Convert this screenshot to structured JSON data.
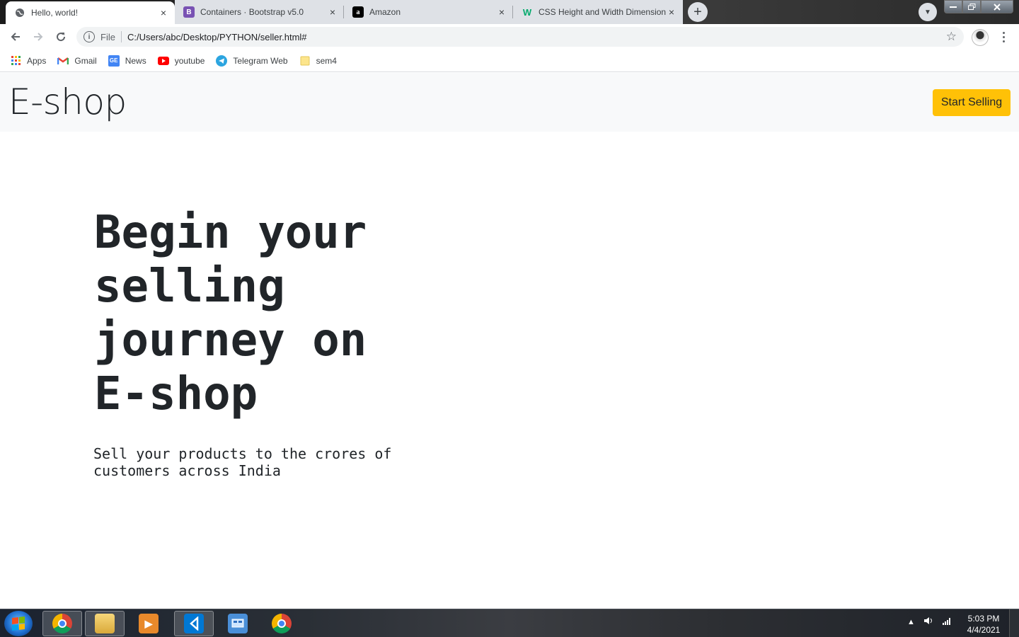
{
  "browser": {
    "tabs": [
      {
        "title": "Hello, world!",
        "favicon": "globe-icon",
        "active": true
      },
      {
        "title": "Containers · Bootstrap v5.0",
        "favicon": "B",
        "favicon_color": "#7952b3",
        "active": false
      },
      {
        "title": "Amazon",
        "favicon": "a",
        "favicon_color": "#000000",
        "active": false
      },
      {
        "title": "CSS Height and Width Dimensions",
        "favicon": "W",
        "favicon_color": "#04aa6d",
        "active": false
      }
    ],
    "new_tab_symbol": "+",
    "tab_close_symbol": "×",
    "address": {
      "scheme_label": "File",
      "url": "C:/Users/abc/Desktop/PYTHON/seller.html#"
    },
    "bookmarks": [
      {
        "label": "Apps",
        "icon": "apps-grid-icon"
      },
      {
        "label": "Gmail",
        "icon": "gmail-icon"
      },
      {
        "label": "News",
        "icon": "google-news-icon"
      },
      {
        "label": "youtube",
        "icon": "youtube-icon"
      },
      {
        "label": "Telegram Web",
        "icon": "telegram-icon"
      },
      {
        "label": "sem4",
        "icon": "folder-icon"
      }
    ]
  },
  "page": {
    "brand": "E-shop",
    "cta_label": "Start Selling",
    "cta_color": "#ffc107",
    "hero_title": "Begin your selling journey on E-shop",
    "hero_subtitle": "Sell your products to the crores of customers across India"
  },
  "taskbar": {
    "items": [
      "chrome-icon",
      "file-explorer-icon",
      "media-player-icon",
      "vscode-icon",
      "control-panel-icon",
      "chrome-icon"
    ],
    "time": "5:03 PM",
    "date": "4/4/2021"
  }
}
